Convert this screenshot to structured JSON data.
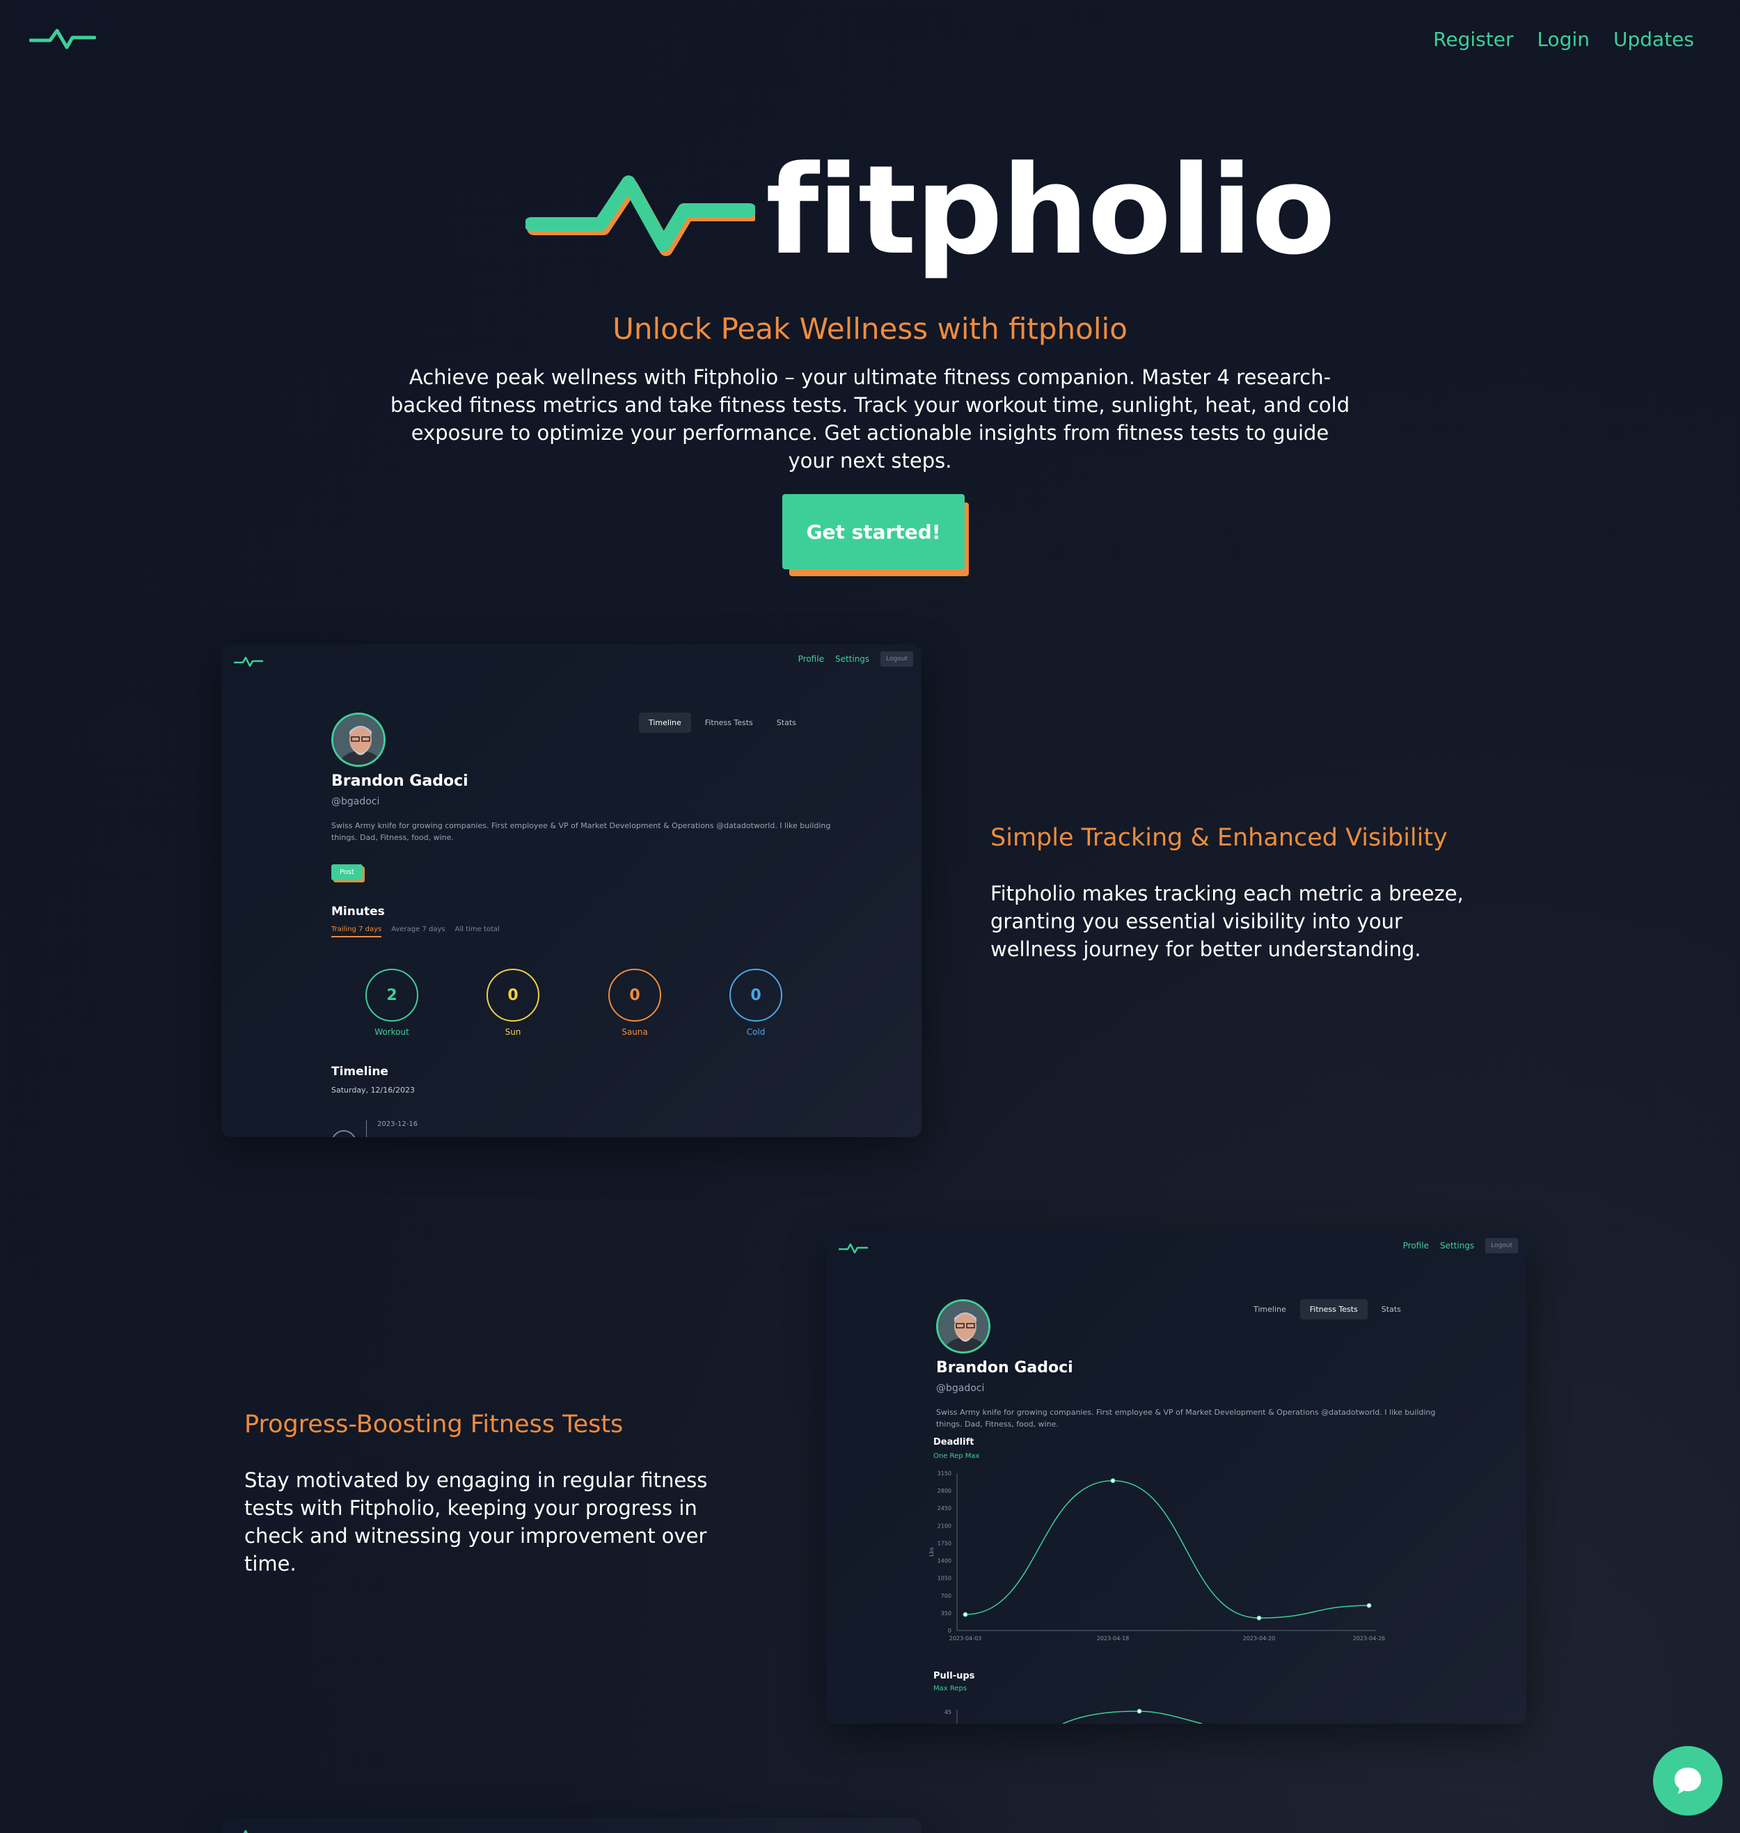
{
  "nav": {
    "links": [
      "Register",
      "Login",
      "Updates"
    ]
  },
  "hero": {
    "wordmark": "fitpholio",
    "tagline": "Unlock Peak Wellness with fitpholio",
    "description": "Achieve peak wellness with Fitpholio – your ultimate fitness companion. Master 4 research-backed fitness metrics and take fitness tests. Track your workout time, sunlight, heat, and cold exposure to optimize your performance. Get actionable insights from fitness tests to guide your next steps.",
    "cta": "Get started!"
  },
  "app": {
    "nav": [
      "Profile",
      "Settings",
      "Logout"
    ],
    "tabs": [
      "Timeline",
      "Fitness Tests",
      "Stats"
    ],
    "profile": {
      "name": "Brandon Gadoci",
      "handle": "@bgadoci",
      "bio": "Swiss Army knife for growing companies. First employee & VP of Market Development & Operations @datadotworld. I like building things. Dad, Fitness, food, wine."
    },
    "post_label": "Post",
    "minutes": {
      "title": "Minutes",
      "subtabs": [
        "Trailing 7 days",
        "Average 7 days",
        "All time total"
      ],
      "metrics": [
        {
          "value": "2",
          "label": "Workout",
          "color": "#3ecf98"
        },
        {
          "value": "0",
          "label": "Sun",
          "color": "#f4cf44"
        },
        {
          "value": "0",
          "label": "Sauna",
          "color": "#ef8c3d"
        },
        {
          "value": "0",
          "label": "Cold",
          "color": "#4ba7e8"
        }
      ]
    },
    "timeline": {
      "title": "Timeline",
      "date": "Saturday, 12/16/2023",
      "entry_date": "2023-12-16"
    }
  },
  "features": [
    {
      "title": "Simple Tracking & Enhanced Visibility",
      "text": "Fitpholio makes tracking each metric a breeze, granting you essential visibility into your wellness journey for better understanding."
    },
    {
      "title": "Progress-Boosting Fitness Tests",
      "text": "Stay motivated by engaging in regular fitness tests with Fitpholio, keeping your progress in check and witnessing your improvement over time."
    }
  ],
  "chart_data": [
    {
      "type": "line",
      "title": "Deadlift",
      "subtitle": "One Rep Max",
      "ylabel": "Lbs",
      "x": [
        "2023-04-03",
        "2023-04-18",
        "2023-04-20",
        "2023-04-26"
      ],
      "values": [
        320,
        3000,
        250,
        500
      ],
      "ylim": [
        0,
        3150
      ],
      "yticks": [
        0,
        350,
        700,
        1050,
        1400,
        1750,
        2100,
        2450,
        2800,
        3150
      ],
      "color": "#3ecf98"
    },
    {
      "type": "line",
      "title": "Pull-ups",
      "subtitle": "Max Reps",
      "yticks": [
        45
      ],
      "color": "#3ecf98"
    }
  ]
}
